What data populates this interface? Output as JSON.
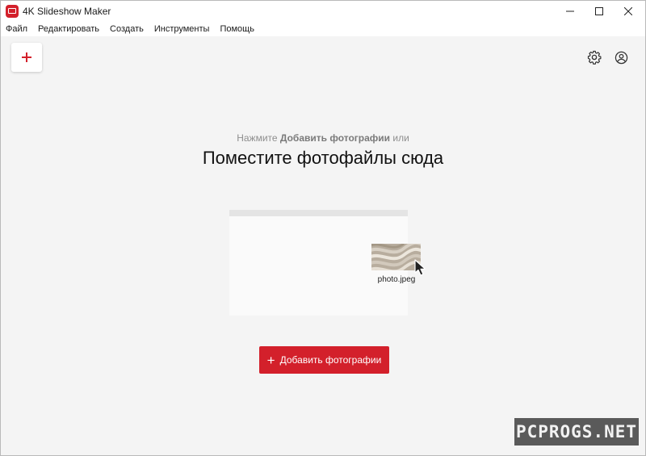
{
  "window": {
    "title": "4K Slideshow Maker",
    "controls": [
      "minimize-icon",
      "maximize-icon",
      "close-icon"
    ]
  },
  "menu": {
    "items": [
      {
        "label": "Файл"
      },
      {
        "label": "Редактировать"
      },
      {
        "label": "Создать"
      },
      {
        "label": "Инструменты"
      },
      {
        "label": "Помощь"
      }
    ]
  },
  "toolbar": {
    "add_icon": "plus-icon",
    "settings_icon": "gear-icon",
    "account_icon": "user-icon"
  },
  "main": {
    "hint_prefix": "Нажмите ",
    "hint_bold": "Добавить фотографии",
    "hint_suffix": " или",
    "headline": "Поместите фотофайлы сюда",
    "illustration": {
      "file_label": "photo.jpeg"
    },
    "cta_label": "Добавить фотографии",
    "cta_icon": "plus-icon"
  },
  "watermark": {
    "text": "PCPROGS.NET"
  },
  "colors": {
    "accent": "#d3202b",
    "background": "#f4f4f4"
  }
}
